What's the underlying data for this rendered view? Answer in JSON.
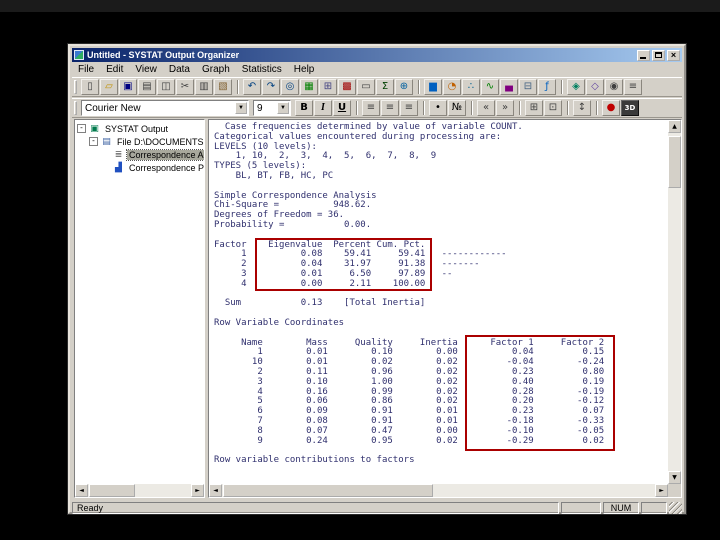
{
  "window": {
    "title": "Untitled - SYSTAT Output Organizer"
  },
  "menu": {
    "items": [
      "File",
      "Edit",
      "View",
      "Data",
      "Graph",
      "Statistics",
      "Help"
    ]
  },
  "icons": {
    "combo_arrow": "▼",
    "scroll_up": "▲",
    "scroll_down": "▼",
    "scroll_left": "◄",
    "scroll_right": "►"
  },
  "main_toolbar": {
    "groups": [
      [
        {
          "name": "new-button",
          "icon": "new-document-icon",
          "glyph": "▯",
          "color": "#404040"
        },
        {
          "name": "open-button",
          "icon": "open-folder-icon",
          "glyph": "▱",
          "color": "#c09000"
        },
        {
          "name": "save-button",
          "icon": "save-icon",
          "glyph": "▣",
          "color": "#000080"
        },
        {
          "name": "print-button",
          "icon": "print-icon",
          "glyph": "▤",
          "color": "#404040"
        },
        {
          "name": "print-preview-button",
          "icon": "print-preview-icon",
          "glyph": "◫",
          "color": "#404040"
        },
        {
          "name": "cut-button",
          "icon": "cut-icon",
          "glyph": "✂",
          "color": "#404040"
        },
        {
          "name": "copy-button",
          "icon": "copy-icon",
          "glyph": "▥",
          "color": "#404040"
        },
        {
          "name": "paste-button",
          "icon": "paste-icon",
          "glyph": "▧",
          "color": "#806030"
        }
      ],
      [
        {
          "name": "undo-button",
          "icon": "undo-icon",
          "glyph": "↶",
          "color": "#004080"
        },
        {
          "name": "redo-button",
          "icon": "redo-icon",
          "glyph": "↷",
          "color": "#004080"
        },
        {
          "name": "find-button",
          "icon": "find-icon",
          "glyph": "◎",
          "color": "#004080"
        },
        {
          "name": "output-organizer-button",
          "icon": "output-organizer-icon",
          "glyph": "▦",
          "color": "#008000"
        },
        {
          "name": "data-editor-button",
          "icon": "data-grid-icon",
          "glyph": "⊞",
          "color": "#404080"
        },
        {
          "name": "graph-gallery-button",
          "icon": "graph-gallery-icon",
          "glyph": "▩",
          "color": "#a00000"
        },
        {
          "name": "dialog-recall-button",
          "icon": "dialog-icon",
          "glyph": "▭",
          "color": "#404040"
        },
        {
          "name": "statistics-button",
          "icon": "sigma-icon",
          "glyph": "Σ",
          "color": "#004000"
        },
        {
          "name": "web-button",
          "icon": "globe-icon",
          "glyph": "⊕",
          "color": "#0060a0"
        }
      ],
      [
        {
          "name": "bar-chart-button",
          "icon": "bar-chart-icon",
          "glyph": "▆",
          "color": "#0060c0"
        },
        {
          "name": "pie-chart-button",
          "icon": "pie-chart-icon",
          "glyph": "◔",
          "color": "#c06000"
        },
        {
          "name": "scatter-plot-button",
          "icon": "scatter-plot-icon",
          "glyph": "∴",
          "color": "#006090"
        },
        {
          "name": "line-chart-button",
          "icon": "line-chart-icon",
          "glyph": "∿",
          "color": "#008000"
        },
        {
          "name": "histogram-button",
          "icon": "histogram-icon",
          "glyph": "▄",
          "color": "#800080"
        },
        {
          "name": "box-plot-button",
          "icon": "box-plot-icon",
          "glyph": "⊟",
          "color": "#406080"
        },
        {
          "name": "function-plot-button",
          "icon": "function-icon",
          "glyph": "ƒ",
          "color": "#0060c0"
        }
      ],
      [
        {
          "name": "map-button",
          "icon": "map-icon",
          "glyph": "◈",
          "color": "#008060"
        },
        {
          "name": "rotate-3d-button",
          "icon": "rotate-3d-icon",
          "glyph": "◇",
          "color": "#6040a0"
        },
        {
          "name": "zoom-button",
          "icon": "zoom-icon",
          "glyph": "◉",
          "color": "#404040"
        },
        {
          "name": "options-button",
          "icon": "options-icon",
          "glyph": "≡",
          "color": "#404040"
        }
      ]
    ]
  },
  "format_toolbar": {
    "font_name": "Courier New",
    "font_size": "9",
    "groups": [
      [
        {
          "name": "bold-button",
          "icon": "bold-icon",
          "glyph": "B",
          "color": "#000000",
          "cls": "g-bold"
        },
        {
          "name": "italic-button",
          "icon": "italic-icon",
          "glyph": "I",
          "color": "#000000",
          "cls": "g-italic"
        },
        {
          "name": "underline-button",
          "icon": "underline-icon",
          "glyph": "U",
          "color": "#000000",
          "cls": "g-underline"
        }
      ],
      [
        {
          "name": "align-left-button",
          "icon": "align-left-icon",
          "glyph": "≡",
          "color": "#404040"
        },
        {
          "name": "align-center-button",
          "icon": "align-center-icon",
          "glyph": "≡",
          "color": "#404040"
        },
        {
          "name": "align-right-button",
          "icon": "align-right-icon",
          "glyph": "≡",
          "color": "#404040"
        }
      ],
      [
        {
          "name": "bullet-list-button",
          "icon": "bullet-list-icon",
          "glyph": "•",
          "color": "#000000"
        },
        {
          "name": "numbered-list-button",
          "icon": "numbered-list-icon",
          "glyph": "№",
          "color": "#000000"
        }
      ],
      [
        {
          "name": "decrease-indent-button",
          "icon": "indent-decrease-icon",
          "glyph": "«",
          "color": "#404040"
        },
        {
          "name": "increase-indent-button",
          "icon": "indent-increase-icon",
          "glyph": "»",
          "color": "#404040"
        }
      ],
      [
        {
          "name": "insert-table-button",
          "icon": "table-icon",
          "glyph": "⊞",
          "color": "#404040"
        },
        {
          "name": "page-margins-button",
          "icon": "margins-icon",
          "glyph": "⊡",
          "color": "#404040"
        }
      ],
      [
        {
          "name": "sort-button",
          "icon": "sort-icon",
          "glyph": "↕",
          "color": "#404040"
        }
      ],
      [
        {
          "name": "record-script-button",
          "icon": "record-icon",
          "glyph": "●",
          "color": "#c00000"
        },
        {
          "name": "graph-3d-button",
          "icon": "three-d-icon",
          "glyph": "3D",
          "color": "#ffffff",
          "cls": "g-dark"
        }
      ]
    ]
  },
  "tree": {
    "items": [
      {
        "label": "SYSTAT Output",
        "level": 0,
        "expander": "-",
        "icon": "output-root-icon",
        "glyph": "▣",
        "icon_color": "#007a4d",
        "selected": false
      },
      {
        "label": "File D:\\DOCUMENTS AN",
        "level": 1,
        "expander": "-",
        "icon": "file-node-icon",
        "glyph": "▤",
        "icon_color": "#3a5fa0",
        "selected": false
      },
      {
        "label": "Correspondence Ana",
        "level": 2,
        "expander": "",
        "icon": "text-output-icon",
        "glyph": "≣",
        "icon_color": "#555555",
        "selected": true
      },
      {
        "label": "Correspondence Plo",
        "level": 2,
        "expander": "",
        "icon": "chart-node-icon",
        "glyph": "▟",
        "icon_color": "#2050c0",
        "selected": false
      }
    ]
  },
  "output": {
    "lines": [
      "  Case frequencies determined by value of variable COUNT.",
      "Categorical values encountered during processing are:",
      "LEVELS (10 levels):",
      "    1, 10,  2,  3,  4,  5,  6,  7,  8,  9",
      "TYPES (5 levels):",
      "    BL, BT, FB, HC, PC",
      "",
      "Simple Correspondence Analysis",
      "Chi-Square =          948.62.",
      "Degrees of Freedom = 36.",
      "Probability =           0.00.",
      "",
      "Factor    Eigenvalue  Percent Cum. Pct.",
      "     1          0.08    59.41     59.41   ------------",
      "     2          0.04    31.97     91.38   -------",
      "     3          0.01     6.50     97.89   --",
      "     4          0.00     2.11    100.00",
      "",
      "  Sum           0.13    [Total Inertia]",
      "",
      "Row Variable Coordinates",
      "",
      "     Name        Mass     Quality     Inertia      Factor 1     Factor 2",
      "        1        0.01        0.10        0.00          0.04         0.15",
      "       10        0.01        0.02        0.02         -0.04        -0.24",
      "        2        0.11        0.96        0.02          0.23         0.80",
      "        3        0.10        1.00        0.02          0.40         0.19",
      "        4        0.16        0.99        0.02          0.28        -0.19",
      "        5        0.06        0.86        0.02          0.20        -0.12",
      "        6        0.09        0.91        0.01          0.23         0.07",
      "        7        0.08        0.91        0.01         -0.18        -0.33",
      "        8        0.07        0.47        0.00         -0.10        -0.05",
      "        9        0.24        0.95        0.02         -0.29         0.02",
      "",
      "Row variable contributions to factors"
    ],
    "tables": {
      "eigenvalues": {
        "columns": [
          "Factor",
          "Eigenvalue",
          "Percent",
          "Cum. Pct."
        ],
        "rows": [
          [
            1,
            0.08,
            59.41,
            59.41
          ],
          [
            2,
            0.04,
            31.97,
            91.38
          ],
          [
            3,
            0.01,
            6.5,
            97.89
          ],
          [
            4,
            0.0,
            2.11,
            100.0
          ]
        ],
        "sum_eigenvalue": 0.13,
        "sum_label": "[Total Inertia]"
      },
      "row_coordinates": {
        "columns": [
          "Name",
          "Mass",
          "Quality",
          "Inertia",
          "Factor 1",
          "Factor 2"
        ],
        "rows": [
          [
            "1",
            0.01,
            0.1,
            0.0,
            0.04,
            0.15
          ],
          [
            "10",
            0.01,
            0.02,
            0.02,
            -0.04,
            -0.24
          ],
          [
            "2",
            0.11,
            0.96,
            0.02,
            0.23,
            0.8
          ],
          [
            "3",
            0.1,
            1.0,
            0.02,
            0.4,
            0.19
          ],
          [
            "4",
            0.16,
            0.99,
            0.02,
            0.28,
            -0.19
          ],
          [
            "5",
            0.06,
            0.86,
            0.02,
            0.2,
            -0.12
          ],
          [
            "6",
            0.09,
            0.91,
            0.01,
            0.23,
            0.07
          ],
          [
            "7",
            0.08,
            0.91,
            0.01,
            -0.18,
            -0.33
          ],
          [
            "8",
            0.07,
            0.47,
            0.0,
            -0.1,
            -0.05
          ],
          [
            "9",
            0.24,
            0.95,
            0.02,
            -0.29,
            0.02
          ]
        ]
      }
    }
  },
  "statusbar": {
    "ready": "Ready",
    "num": "NUM"
  },
  "colors": {
    "titlebar_left": "#0a246a",
    "titlebar_right": "#a6caf0",
    "window_chrome": "#d4d0c8",
    "annotation_red": "#aa0000",
    "output_text": "#30306e",
    "tree_selection": "#a8a89c"
  }
}
